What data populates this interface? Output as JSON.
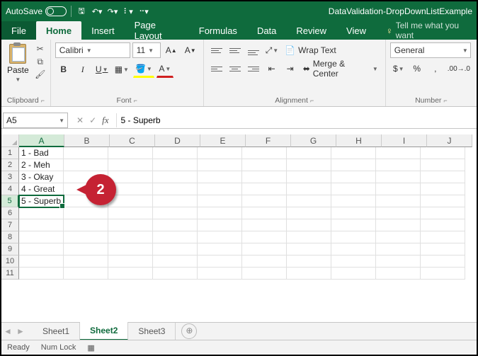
{
  "titlebar": {
    "autosave_label": "AutoSave",
    "autosave_state": "On",
    "doc_title": "DataValidation-DropDownListExample"
  },
  "tabs": {
    "file": "File",
    "home": "Home",
    "insert": "Insert",
    "page_layout": "Page Layout",
    "formulas": "Formulas",
    "data": "Data",
    "review": "Review",
    "view": "View",
    "tell_me": "Tell me what you want"
  },
  "ribbon": {
    "clipboard": {
      "label": "Clipboard",
      "paste": "Paste"
    },
    "font": {
      "label": "Font",
      "name": "Calibri",
      "size": "11",
      "bold": "B",
      "italic": "I",
      "underline": "U"
    },
    "alignment": {
      "label": "Alignment",
      "wrap_text": "Wrap Text",
      "merge_center": "Merge & Center"
    },
    "number": {
      "label": "Number",
      "format": "General",
      "currency": "$",
      "percent": "%",
      "comma": ","
    }
  },
  "namebox": {
    "ref": "A5"
  },
  "formula": {
    "value": "5 - Superb"
  },
  "columns": [
    "A",
    "B",
    "C",
    "D",
    "E",
    "F",
    "G",
    "H",
    "I",
    "J"
  ],
  "rows": [
    1,
    2,
    3,
    4,
    5,
    6,
    7,
    8,
    9,
    10,
    11
  ],
  "cells": {
    "A1": "1 - Bad",
    "A2": "2 - Meh",
    "A3": "3 - Okay",
    "A4": "4 - Great",
    "A5": "5 - Superb"
  },
  "selected_cell": "A5",
  "callout": {
    "number": "2"
  },
  "sheets": {
    "s1": "Sheet1",
    "s2": "Sheet2",
    "s3": "Sheet3",
    "new": "⊕"
  },
  "status": {
    "ready": "Ready",
    "numlock": "Num Lock"
  }
}
